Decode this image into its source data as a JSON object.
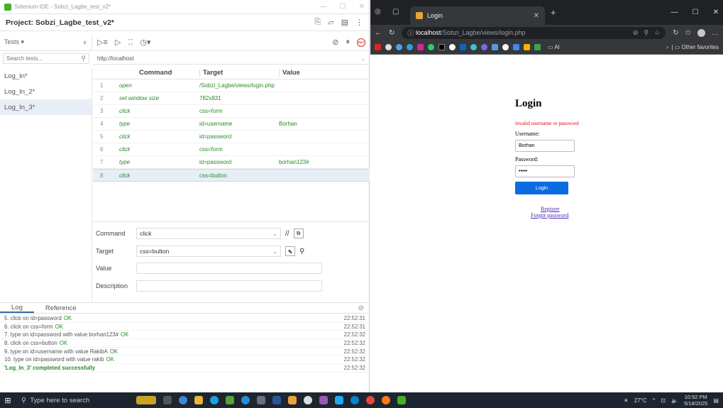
{
  "ide": {
    "window_title": "Selenium IDE - Sobzi_Lagbe_test_v2*",
    "project_title": "Project: Sobzi_Lagbe_test_v2*",
    "tests_label": "Tests",
    "tests_dropdown": "▾",
    "search_placeholder": "Search tests...",
    "tests": [
      "Log_In*",
      "Log_In_2*",
      "Log_In_3*"
    ],
    "active_test_index": 2,
    "base_url": "http://localhost",
    "columns": {
      "command": "Command",
      "target": "Target",
      "value": "Value"
    },
    "commands": [
      {
        "num": "1",
        "command": "open",
        "target": "/Sobzi_Lagbe/views/login.php",
        "value": ""
      },
      {
        "num": "2",
        "command": "set window size",
        "target": "782x831",
        "value": ""
      },
      {
        "num": "3",
        "command": "click",
        "target": "css=form",
        "value": ""
      },
      {
        "num": "4",
        "command": "type",
        "target": "id=username",
        "value": "Borhan"
      },
      {
        "num": "5",
        "command": "click",
        "target": "id=password",
        "value": ""
      },
      {
        "num": "6",
        "command": "click",
        "target": "css=form",
        "value": ""
      },
      {
        "num": "7",
        "command": "type",
        "target": "id=password",
        "value": "borhan123#"
      },
      {
        "num": "8",
        "command": "click",
        "target": "css=button",
        "value": ""
      }
    ],
    "active_command_index": 7,
    "editor": {
      "command_label": "Command",
      "command_value": "click",
      "target_label": "Target",
      "target_value": "css=button",
      "value_label": "Value",
      "value_value": "",
      "description_label": "Description",
      "description_value": "",
      "comment_btn": "//"
    },
    "log_tabs": [
      "Log",
      "Reference"
    ],
    "log": [
      {
        "msg": "5.  click on id=password",
        "ok": "OK",
        "time": "22:52:31"
      },
      {
        "msg": "6.  click on css=form",
        "ok": "OK",
        "time": "22:52:31"
      },
      {
        "msg": "7.  type on id=password with value borhan123#",
        "ok": "OK",
        "time": "22:52:32"
      },
      {
        "msg": "8.  click on css=button",
        "ok": "OK",
        "time": "22:52:32"
      },
      {
        "msg": "9.  type on id=username with value RakibA",
        "ok": "OK",
        "time": "22:52:32"
      },
      {
        "msg": "10. type on id=password with value rakib",
        "ok": "OK",
        "time": "22:52:32"
      },
      {
        "msg": "'Log_In_3' completed successfully",
        "ok": "",
        "time": "22:52:32"
      }
    ]
  },
  "browser": {
    "tab_title": "Login",
    "address_host": "localhost",
    "address_path": "/Sobzi_Lagbe/views/login.php",
    "bookmarks_folder": "AI",
    "other_favorites": "Other favorites",
    "page": {
      "heading": "Login",
      "error": "invalid username or password",
      "username_label": "Username:",
      "username_value": "Borhan",
      "password_label": "Password:",
      "password_value": "•••••",
      "login_button": "Login",
      "register_link": "Register",
      "forgot_link": "Forgot password"
    }
  },
  "taskbar": {
    "search_placeholder": "Type here to search",
    "weather": "27°C",
    "time": "10:52 PM",
    "date": "5/18/2025"
  },
  "colors": {
    "accent_green": "#2a8a2a",
    "selection": "#e6eef6",
    "error_red": "#e00000",
    "login_button": "#0a6ce0",
    "browser_dark": "#202124"
  }
}
